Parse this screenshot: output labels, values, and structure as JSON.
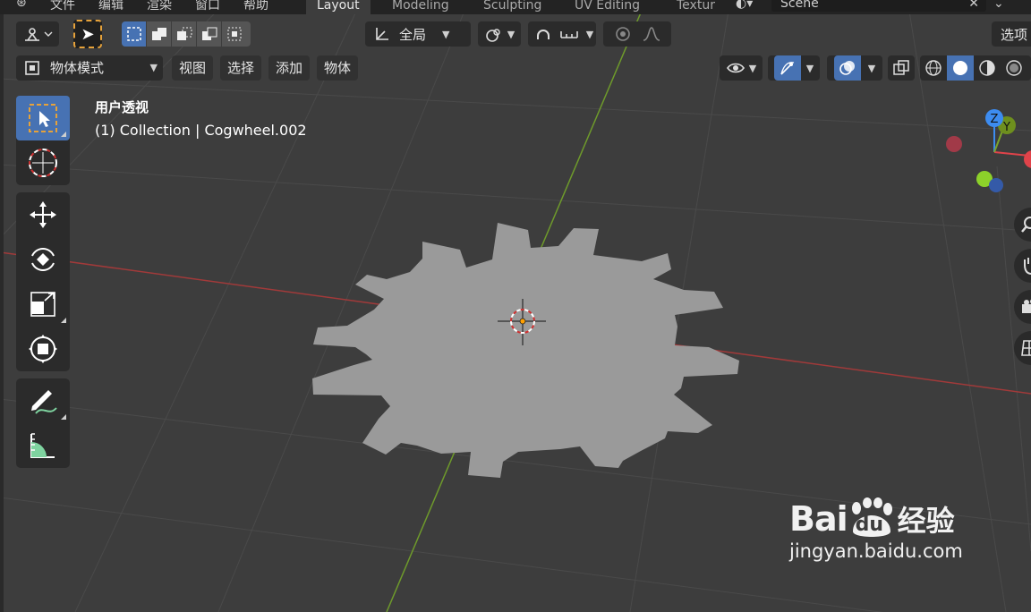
{
  "top_menu": {
    "file": "文件",
    "edit": "编辑",
    "render": "渲染",
    "window": "窗口",
    "help": "帮助"
  },
  "workspace_tabs": [
    {
      "label": "Layout",
      "active": true
    },
    {
      "label": "Modeling",
      "active": false
    },
    {
      "label": "Sculpting",
      "active": false
    },
    {
      "label": "UV Editing",
      "active": false
    },
    {
      "label": "Textur",
      "active": false
    }
  ],
  "scene": {
    "name": "Scene"
  },
  "header": {
    "transform_orientation": "全局",
    "options": "选项",
    "mode": "物体模式",
    "menus": [
      "视图",
      "选择",
      "添加",
      "物体"
    ]
  },
  "viewport_info": {
    "view_name": "用户透视",
    "collection": "(1) Collection | Cogwheel.002"
  },
  "gizmo": {
    "z_label": "Z",
    "y_label": "Y"
  },
  "colors": {
    "accent": "#4772b3",
    "x_axis": "#c0393b",
    "y_axis": "#7aa32b",
    "z_axis": "#3d8cf0",
    "gear": "#9a9a9a",
    "background": "#3d3d3d"
  },
  "icons": {
    "toolbar": [
      "select-box-icon",
      "cursor-icon",
      "move-icon",
      "rotate-icon",
      "scale-icon",
      "transform-icon",
      "annotate-icon",
      "measure-icon"
    ],
    "right_nav": [
      "zoom-icon",
      "pan-hand-icon",
      "camera-icon",
      "grid-icon"
    ]
  },
  "watermark": {
    "brand": "Bai",
    "brand2": "du",
    "brand3": "经验",
    "url": "jingyan.baidu.com"
  }
}
